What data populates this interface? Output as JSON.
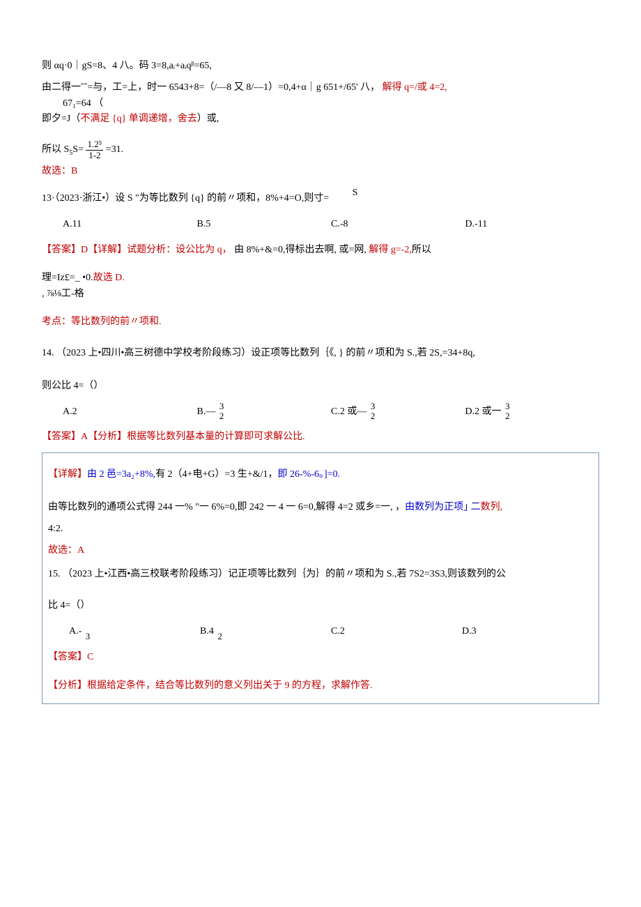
{
  "p1": "则 αq·0｜gS=8、4 八。码 3=8,aᵢ+aᵢqᵝ=65,",
  "p2": "由二得一ˆˆ=与，工=上，时一 6543+8=（/—8 又 8/—1）=0,4+α｜g       651+/65' 八，",
  "p2red": "解得 q=/或 4=2,",
  "p3a": "67₁=64                                       （",
  "p3b": "即夕=J（",
  "p3b_red": "不满足 {q} 单调递增，舍去",
  "p3c": "）或,",
  "p4a": "所以 S",
  "p4b": "S=",
  "p4num": "1.2⁵",
  "p4mid": "-------",
  "p4den": "1-2",
  "p4c": "=31.",
  "p5": "故选：B",
  "q13_a": "13·（2023·浙江•）设 S \"为等比数列 {q} 的前〃项和，8%+4=O,则寸=",
  "q13_b": "S",
  "q13_opts": {
    "A": "A.11",
    "B": "B.5",
    "C": "C.-8",
    "D": "D.-11"
  },
  "q13_ans1": "【答案】D【详解】试题分析：设公比为 q，",
  "q13_ans1b": " 由 8%+&=0,得标出去啊, 或=网, ",
  "q13_ans1c": "解得 g=-2,",
  "q13_ans1d": "所以",
  "q13_ans2a": "理=Iz£=_ •0.",
  "q13_ans2b": "故选 D.",
  "q13_ans3": ", ⅞⅛工-格",
  "q13_pt": "考点：等比数列的前〃项和.",
  "q14_stem": "14.  （2023 上•四川•高三树德中学校考阶段练习）设正项等比数列｛《, } 的前〃项和为 S.,若 2S,=34+8q,",
  "q14_stem2": "则公比 4=（）",
  "q14_opts": {
    "A": "A.2",
    "B1": "B.—",
    "B_num": "3",
    "B_den": "2",
    "C1": "C.2 或—",
    "C_num": "3",
    "C_den": "2",
    "D1": "D.2 或一",
    "D_num": "3",
    "D_den": "2"
  },
  "q14_ans_label": "【答案】A【分析】根据等比数列基本量的计算即可求解公比.",
  "q14_det1a": "【详解】",
  "q14_det1b": "由 2 邑=3a₂+8%,",
  "q14_det1c": "有 2（4+电+G）=3 生+&/1，",
  "q14_det1d": "即 26-%-6。]=0.",
  "q14_det2a": "由等比数列的通项公式得 244 一% \"一 6%=0,即 242 一 4 一 6=0,解得 4=2 或乡=一, ，",
  "q14_det2b": "由数列为正项｣ 二",
  "q14_det2c": "数列,",
  "q14_det3": "4:2.",
  "q14_sel": "故选：A",
  "q15_stem": "15.   （2023 上•江西•高三校联考阶段练习）记正项等比数列｛为｝的前〃项和为 S.,若 7S2=3S3,则该数列的公",
  "q15_stem2": "比 4=（）",
  "q15_opts": {
    "A": "A.-",
    "A_den": "3",
    "B": "B.4",
    "B_den": "2",
    "C": "C.2",
    "D": "D.3"
  },
  "q15_ans": "【答案】C",
  "q15_anal": "【分析】根据给定条件，结合等比数列的意义列出关于 9 的方程，求解作答."
}
